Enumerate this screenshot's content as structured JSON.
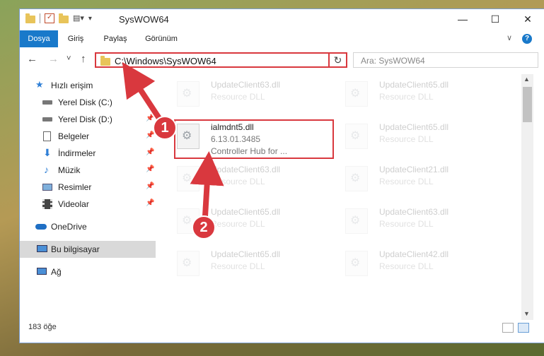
{
  "window": {
    "title": "SysWOW64",
    "minimize": "—",
    "maximize": "☐",
    "close": "✕"
  },
  "ribbon": {
    "tabs": [
      "Dosya",
      "Giriş",
      "Paylaş",
      "Görünüm"
    ],
    "expand": "∨",
    "help": "?"
  },
  "nav": {
    "back": "←",
    "forward": "→",
    "recent": "˅",
    "up": "↑",
    "address": "C:\\Windows\\SysWOW64",
    "address_chevron": "∨",
    "refresh": "↻",
    "search_placeholder": "Ara: SysWOW64"
  },
  "sidebar": {
    "items": [
      {
        "label": "Hızlı erişim",
        "icon": "star-icon"
      },
      {
        "label": "Yerel Disk (C:)",
        "icon": "drive-icon"
      },
      {
        "label": "Yerel Disk (D:)",
        "icon": "drive-icon"
      },
      {
        "label": "Belgeler",
        "icon": "documents-icon"
      },
      {
        "label": "İndirmeler",
        "icon": "download-icon"
      },
      {
        "label": "Müzik",
        "icon": "music-icon"
      },
      {
        "label": "Resimler",
        "icon": "pictures-icon"
      },
      {
        "label": "Videolar",
        "icon": "video-icon"
      },
      {
        "label": "OneDrive",
        "icon": "cloud-icon"
      },
      {
        "label": "Bu bilgisayar",
        "icon": "computer-icon"
      },
      {
        "label": "Ağ",
        "icon": "network-icon"
      }
    ]
  },
  "files": [
    {
      "name": "UpdateClient63.dll",
      "sub1": "Resource DLL"
    },
    {
      "name": "UpdateClient65.dll",
      "sub1": "Resource DLL"
    },
    {
      "name": "ialmdnt5.dll",
      "sub1": "6.13.01.3485",
      "sub2": "Controller Hub for ..."
    },
    {
      "name": "UpdateClient65.dll",
      "sub1": "Resource DLL"
    },
    {
      "name": "UpdateClient63.dll",
      "sub1": "Resource DLL"
    },
    {
      "name": "UpdateClient21.dll",
      "sub1": "Resource DLL"
    },
    {
      "name": "UpdateClient65.dll",
      "sub1": "Resource DLL"
    },
    {
      "name": "UpdateClient63.dll",
      "sub1": "Resource DLL"
    },
    {
      "name": "UpdateClient65.dll",
      "sub1": "Resource DLL"
    },
    {
      "name": "UpdateClient42.dll",
      "sub1": "Resource DLL"
    }
  ],
  "status": {
    "count": "183 öğe"
  },
  "annotations": {
    "step1": "1",
    "step2": "2",
    "color": "#d9383e"
  }
}
